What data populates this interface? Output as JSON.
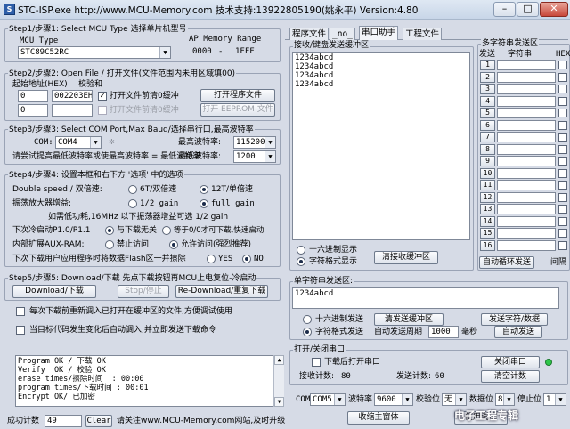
{
  "window": {
    "title": "STC-ISP.exe      http://www.MCU-Memory.com 技术支持:13922805190(姚永平) Version:4.80",
    "icon_label": "S",
    "buttons": {
      "minimize": "–",
      "maximize": "□",
      "close": "✕"
    }
  },
  "step1": {
    "legend": "Step1/步骤1: Select MCU Type  选择单片机型号",
    "mcu_type_label": "MCU Type",
    "ap_memory_label": "AP Memory Range",
    "mcu_value": "STC89C52RC",
    "range_start": "0000",
    "range_sep": "-",
    "range_end": "1FFF"
  },
  "step2": {
    "legend": "Step2/步骤2: Open File / 打开文件(文件范围内未用区域填00)",
    "start_addr_label": "起始地址(HEX)",
    "checksum_label": "校验和",
    "addr1": "0",
    "checksum1": "002203EH",
    "clear_buffer1": "打开文件前清0缓冲",
    "open_program_button": "打开程序文件",
    "addr2": "0",
    "checksum2": "",
    "clear_buffer2": "打开文件前清0缓冲",
    "open_eeprom_button": "打开 EEPROM 文件"
  },
  "step3": {
    "legend": "Step3/步骤3: Select COM Port,Max Baud/选择串行口,最高波特率",
    "com_label": "COM:",
    "com_value": "COM4",
    "max_baud_label": "最高波特率:",
    "max_baud_value": "115200",
    "min_baud_note": "请尝试提高最低波特率或使最高波特率 = 最低波特率",
    "min_baud_label": "最低波特率:",
    "min_baud_value": "1200"
  },
  "step4": {
    "legend": "Step4/步骤4: 设置本框和右下方 '选项' 中的选项",
    "double_speed_label": "Double speed / 双倍速:",
    "opt_6t": "6T/双倍速",
    "opt_12t": "12T/单倍速",
    "amp_gain_label": "振荡放大器增益:",
    "opt_half_gain": "1/2 gain",
    "opt_full_gain": "full gain",
    "gain_note": "如需低功耗,16MHz 以下振荡器增益可选 1/2 gain",
    "next_cold_start_label": "下次冷启动P1.0/P1.1",
    "opt_unrelated": "与下载无关",
    "opt_equal_zero": "等于0/0才可下载,快速启动",
    "aux_ram_label": "内部扩展AUX-RAM:",
    "opt_disable": "禁止访问",
    "opt_allow": "允许访问(强烈推荐)",
    "erase_flash_label": "下次下载用户应用程序时将数据Flash区一并擦除",
    "opt_yes": "YES",
    "opt_no": "NO"
  },
  "step5": {
    "legend": "Step5/步骤5: Download/下载  先点下载按钮再MCU上电复位-冷启动",
    "download_button": "Download/下载",
    "stop_button": "Stop/停止",
    "redownload_button": "Re-Download/重复下载",
    "reload_each_time": "每次下载前重新调入已打开在缓冲区的文件,方便调试使用",
    "auto_reload_label": "当目标代码发生变化后自动调入,并立即发送下载命令"
  },
  "log": {
    "lines": "Program OK / 下载 OK\nVerify  OK / 校验 OK\nerase times/擦除时间  : 00:00\nprogram times/下载时间 : 00:01\nEncrypt OK/ 已加密"
  },
  "status": {
    "success_count_label": "成功计数",
    "success_count": "49",
    "clear_button": "Clear",
    "ad_text": "请关注www.MCU-Memory.com网站,及时升级"
  },
  "tabs": [
    {
      "label": "程序文件"
    },
    {
      "label": "_no_"
    },
    {
      "label": "串口助手"
    },
    {
      "label": "工程文件"
    }
  ],
  "receive": {
    "legend": "接收/键盘发送缓冲区",
    "text": "1234abcd\n1234abcd\n1234abcd\n1234abcd",
    "hex_display": "十六进制显示",
    "char_display": "字符格式显示",
    "clear_button": "清接收缓冲区"
  },
  "multi_send": {
    "legend": "多字符串发送区",
    "col_send": "发送",
    "col_string": "字符串",
    "col_hex": "HEX",
    "rows": [
      "1",
      "2",
      "3",
      "4",
      "5",
      "6",
      "7",
      "8",
      "9",
      "10",
      "11",
      "12",
      "13",
      "14",
      "15",
      "16"
    ],
    "auto_loop_button": "自动循环发送",
    "interval_label": "间隔"
  },
  "single_send": {
    "legend": "单字符串发送区:",
    "text": "1234abcd",
    "hex_send": "十六进制发送",
    "char_send": "字符格式发送",
    "clear_button": "清发送缓冲区",
    "auto_send_period_label": "自动发送周期",
    "period_value": "1000",
    "ms_label": "毫秒",
    "send_string_button": "发送字符/数据",
    "auto_send_button": "自动发送"
  },
  "port": {
    "legend": "打开/关闭串口",
    "open_after_download": "下载后打开串口",
    "close_button": "关闭串口",
    "rx_count_label": "接收计数:",
    "rx_count": "80",
    "tx_count_label": "发送计数:",
    "tx_count": "60",
    "clear_count_button": "清空计数",
    "com_label": "COM",
    "com_value": "COM5",
    "baud_label": "波特率",
    "baud_value": "9600",
    "parity_label": "校验位",
    "parity_value": "无",
    "databits_label": "数据位",
    "databits_value": "8",
    "stopbits_label": "停止位",
    "stopbits_value": "1",
    "main_window_button": "收缩主窗体",
    "help_button": "使用说明"
  },
  "watermark": "电子工程专辑"
}
